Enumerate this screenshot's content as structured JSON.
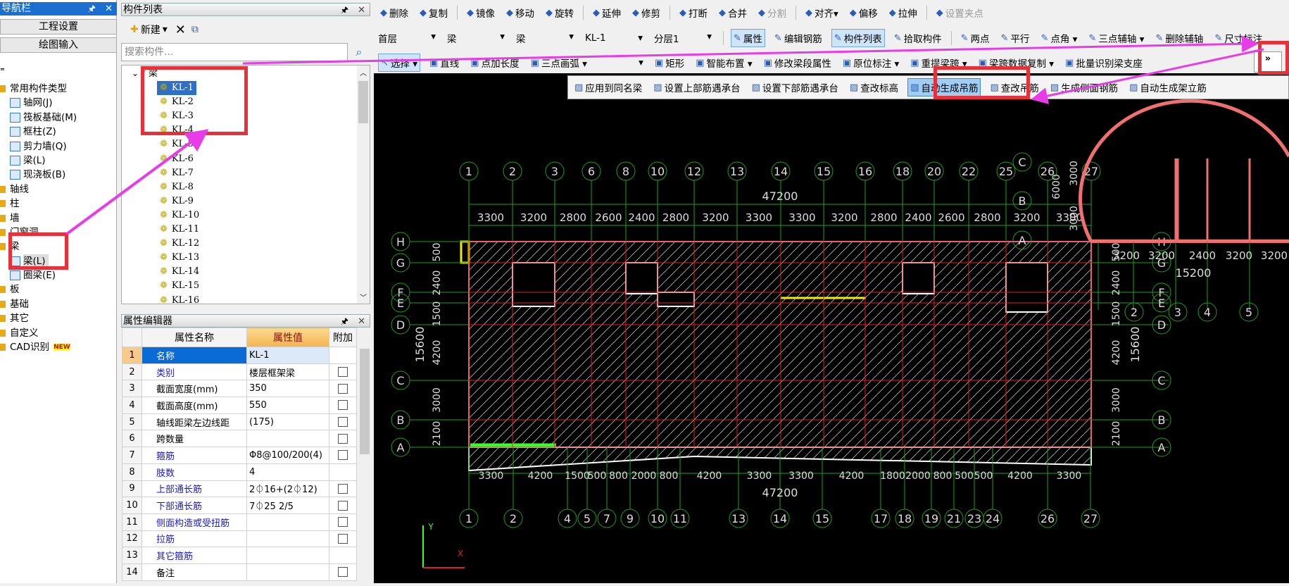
{
  "nav": {
    "title": "导航栏",
    "buttons": [
      "工程设置",
      "绘图输入"
    ],
    "items": [
      {
        "label": "常用构件类型",
        "level": 0
      },
      {
        "label": "轴网(J)",
        "level": 1
      },
      {
        "label": "筏板基础(M)",
        "level": 1
      },
      {
        "label": "框柱(Z)",
        "level": 1
      },
      {
        "label": "剪力墙(Q)",
        "level": 1
      },
      {
        "label": "梁(L)",
        "level": 1
      },
      {
        "label": "现浇板(B)",
        "level": 1
      },
      {
        "label": "轴线",
        "level": 0
      },
      {
        "label": "柱",
        "level": 0
      },
      {
        "label": "墙",
        "level": 0
      },
      {
        "label": "门窗洞",
        "level": 0
      },
      {
        "label": "梁",
        "level": 0
      },
      {
        "label": "梁(L)",
        "level": 1,
        "selected": true
      },
      {
        "label": "圈梁(E)",
        "level": 1
      },
      {
        "label": "板",
        "level": 0
      },
      {
        "label": "基础",
        "level": 0
      },
      {
        "label": "其它",
        "level": 0
      },
      {
        "label": "自定义",
        "level": 0
      },
      {
        "label": "CAD识别",
        "level": 0,
        "badge": "NEW"
      }
    ]
  },
  "list": {
    "title": "构件列表",
    "new_label": "新建",
    "search_placeholder": "搜索构件...",
    "root": "梁",
    "items": [
      "KL-1",
      "KL-2",
      "KL-3",
      "KL-4",
      "KL-5",
      "KL-6",
      "KL-7",
      "KL-8",
      "KL-9",
      "KL-10",
      "KL-11",
      "KL-12",
      "KL-13",
      "KL-14",
      "KL-15",
      "KL-16"
    ],
    "selected": "KL-1"
  },
  "props": {
    "title": "属性编辑器",
    "headers": [
      "属性名称",
      "属性值",
      "附加"
    ],
    "rows": [
      {
        "no": "1",
        "name": "名称",
        "value": "KL-1",
        "blue": true,
        "check": false
      },
      {
        "no": "2",
        "name": "类别",
        "value": "楼层框架梁",
        "blue": true,
        "check": true
      },
      {
        "no": "3",
        "name": "截面宽度(mm)",
        "value": "350",
        "blue": false,
        "check": true
      },
      {
        "no": "4",
        "name": "截面高度(mm)",
        "value": "550",
        "blue": false,
        "check": true
      },
      {
        "no": "5",
        "name": "轴线距梁左边线距",
        "value": "(175)",
        "blue": false,
        "check": true
      },
      {
        "no": "6",
        "name": "跨数量",
        "value": "",
        "blue": false,
        "check": true
      },
      {
        "no": "7",
        "name": "箍筋",
        "value": "Φ8@100/200(4)",
        "blue": true,
        "check": true
      },
      {
        "no": "8",
        "name": "肢数",
        "value": "4",
        "blue": true,
        "check": false
      },
      {
        "no": "9",
        "name": "上部通长筋",
        "value": "2⏀16+(2⏀12)",
        "blue": true,
        "check": true
      },
      {
        "no": "10",
        "name": "下部通长筋",
        "value": "7⏀25 2/5",
        "blue": true,
        "check": true
      },
      {
        "no": "11",
        "name": "侧面构造或受扭筋",
        "value": "",
        "blue": true,
        "check": true
      },
      {
        "no": "12",
        "name": "拉筋",
        "value": "",
        "blue": true,
        "check": true
      },
      {
        "no": "13",
        "name": "其它箍筋",
        "value": "",
        "blue": true,
        "check": false
      },
      {
        "no": "14",
        "name": "备注",
        "value": "",
        "blue": false,
        "check": true
      }
    ]
  },
  "toolbar1": [
    {
      "label": "删除",
      "icon": "eraser-icon"
    },
    {
      "label": "复制",
      "icon": "copy-icon"
    },
    {
      "label": "镜像",
      "icon": "mirror-icon"
    },
    {
      "label": "移动",
      "icon": "move-icon"
    },
    {
      "label": "旋转",
      "icon": "rotate-icon"
    },
    {
      "label": "延伸",
      "icon": "extend-icon"
    },
    {
      "label": "修剪",
      "icon": "trim-icon"
    },
    {
      "label": "打断",
      "icon": "break-icon"
    },
    {
      "label": "合并",
      "icon": "merge-icon"
    },
    {
      "label": "分割",
      "icon": "split-icon",
      "disabled": true
    },
    {
      "label": "对齐▾",
      "icon": "align-icon"
    },
    {
      "label": "偏移",
      "icon": "offset-icon"
    },
    {
      "label": "拉伸",
      "icon": "stretch-icon"
    },
    {
      "label": "设置夹点",
      "icon": "grip-icon",
      "disabled": true
    }
  ],
  "toolbar2": {
    "dropdowns": [
      "首层",
      "梁",
      "梁",
      "KL-1",
      "分层1"
    ],
    "buttons": [
      {
        "label": "属性",
        "active": true
      },
      {
        "label": "编辑钢筋"
      },
      {
        "label": "构件列表",
        "active": true
      },
      {
        "label": "拾取构件"
      },
      {
        "label": "两点"
      },
      {
        "label": "平行"
      },
      {
        "label": "点角 ▾"
      },
      {
        "label": "三点辅轴 ▾"
      },
      {
        "label": "删除辅轴"
      },
      {
        "label": "尺寸标注"
      }
    ]
  },
  "toolbar3": {
    "buttons": [
      {
        "label": "选择 ▾",
        "active": true
      },
      {
        "label": "直线"
      },
      {
        "label": "点加长度"
      },
      {
        "label": "三点画弧 ▾"
      },
      {
        "label": "▾"
      },
      {
        "label": "矩形"
      },
      {
        "label": "智能布置 ▾"
      },
      {
        "label": "修改梁段属性"
      },
      {
        "label": "原位标注 ▾"
      },
      {
        "label": "重提梁跨 ▾"
      },
      {
        "label": "梁跨数据复制 ▾"
      },
      {
        "label": "批量识别梁支座"
      }
    ],
    "overflow": "»"
  },
  "popup": [
    {
      "label": "应用到同名梁"
    },
    {
      "label": "设置上部筋遇承台"
    },
    {
      "label": "设置下部筋遇承台"
    },
    {
      "label": "查改标高"
    },
    {
      "label": "自动生成吊筋",
      "highlight": true
    },
    {
      "label": "查改吊筋"
    },
    {
      "label": "生成侧面钢筋"
    },
    {
      "label": "自动生成架立筋"
    }
  ],
  "cad": {
    "top_axes": [
      "1",
      "2",
      "3",
      "6",
      "8",
      "10",
      "12",
      "13",
      "14",
      "15",
      "16",
      "18",
      "20",
      "22",
      "25",
      "26",
      "27"
    ],
    "top_total": "47200",
    "top_dims": [
      "3300",
      "3200",
      "2800",
      "2600",
      "2400",
      "2800",
      "3200",
      "3300",
      "3300",
      "3200",
      "2800",
      "2400",
      "2600",
      "2800",
      "3200",
      "3300"
    ],
    "bottom_axes": [
      "1",
      "2",
      "4",
      "5",
      "7",
      "9",
      "10",
      "11",
      "13",
      "14",
      "15",
      "17",
      "18",
      "19",
      "21",
      "23",
      "24",
      "26",
      "27"
    ],
    "bottom_dims": [
      "3300",
      "4200",
      "1500",
      "500",
      "800",
      "2000",
      "800",
      "4200",
      "3300",
      "3300",
      "4200",
      "1800",
      "2000",
      "800",
      "500",
      "500",
      "4200",
      "3300"
    ],
    "bottom_total": "47200",
    "rows": [
      "H",
      "G",
      "F",
      "E",
      "D",
      "C",
      "B",
      "A"
    ],
    "left_dims": [
      "500",
      "2400",
      "1500",
      "4200",
      "3000",
      "2100"
    ],
    "left_total": "15600",
    "annex_axes": [
      "C",
      "B",
      "A"
    ],
    "annex_dims": [
      "6000",
      "3000",
      "3000"
    ],
    "arch_dims": [
      "3200",
      "3200",
      "2400",
      "3200",
      "3200"
    ],
    "arch_total": "15200",
    "arch_axes": [
      "2",
      "3",
      "4",
      "5"
    ],
    "ucs": {
      "x": "X",
      "y": "Y"
    }
  },
  "colors": {
    "annotation_box": "#e8303a",
    "annotation_arrow": "#e83ce8",
    "grid": "#1e9e1e",
    "canvas": "#000000",
    "selection": "#0b6bd6"
  }
}
